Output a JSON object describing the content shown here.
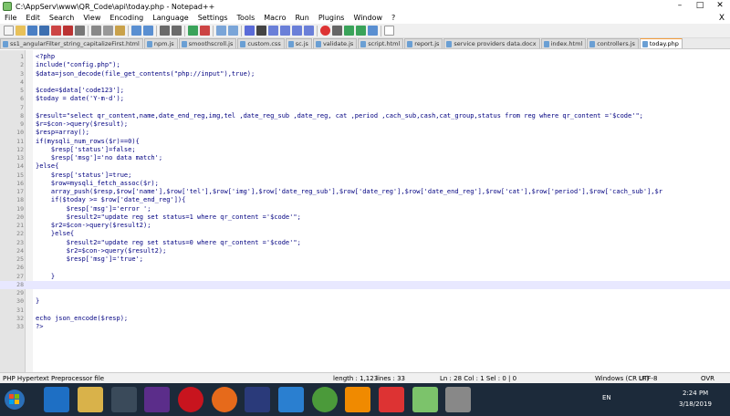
{
  "window": {
    "title": "C:\\AppServ\\www\\QR_Code\\api\\today.php - Notepad++",
    "minimize": "–",
    "maximize": "□",
    "close": "✕"
  },
  "menu": {
    "items": [
      "File",
      "Edit",
      "Search",
      "View",
      "Encoding",
      "Language",
      "Settings",
      "Tools",
      "Macro",
      "Run",
      "Plugins",
      "Window",
      "?"
    ],
    "close_doc": "X"
  },
  "tabs": [
    {
      "label": "ss1_angularFilter_string_capitalizeFirst.html"
    },
    {
      "label": "npm.js"
    },
    {
      "label": "smoothscroll.js"
    },
    {
      "label": "custom.css"
    },
    {
      "label": "sc.js"
    },
    {
      "label": "validate.js"
    },
    {
      "label": "script.html"
    },
    {
      "label": "report.js"
    },
    {
      "label": "service providers data.docx"
    },
    {
      "label": "index.html"
    },
    {
      "label": "controllers.js"
    },
    {
      "label": "today.php",
      "active": true
    }
  ],
  "code": {
    "lines": [
      {
        "n": "1",
        "text": "<?php"
      },
      {
        "n": "2",
        "text": "include(\"config.php\");"
      },
      {
        "n": "3",
        "text": "$data=json_decode(file_get_contents(\"php://input\"),true);"
      },
      {
        "n": "4",
        "text": ""
      },
      {
        "n": "5",
        "text": "$code=$data['code123'];"
      },
      {
        "n": "6",
        "text": "$today = date('Y-m-d');"
      },
      {
        "n": "7",
        "text": ""
      },
      {
        "n": "8",
        "text": "$result=\"select qr_content,name,date_end_reg,img,tel ,date_reg_sub ,date_reg, cat ,period ,cach_sub,cash,cat_group,status from reg where qr_content ='$code'\";"
      },
      {
        "n": "9",
        "text": "$r=$con->query($result);"
      },
      {
        "n": "10",
        "text": "$resp=array();"
      },
      {
        "n": "11",
        "text": "if(mysqli_num_rows($r)==0){"
      },
      {
        "n": "12",
        "text": "    $resp['status']=false;"
      },
      {
        "n": "13",
        "text": "    $resp['msg']='no data match';"
      },
      {
        "n": "14",
        "text": "}else{"
      },
      {
        "n": "15",
        "text": "    $resp['status']=true;"
      },
      {
        "n": "16",
        "text": "    $row=mysqli_fetch_assoc($r);"
      },
      {
        "n": "17",
        "text": "    array_push($resp,$row['name'],$row['tel'],$row['img'],$row['date_reg_sub'],$row['date_reg'],$row['date_end_reg'],$row['cat'],$row['period'],$row['cach_sub'],$r"
      },
      {
        "n": "18",
        "text": "    if($today >= $row['date_end_reg']){"
      },
      {
        "n": "19",
        "text": "        $resp['msg']='error ';"
      },
      {
        "n": "20",
        "text": "        $result2=\"update reg set status=1 where qr_content ='$code'\";"
      },
      {
        "n": "21",
        "text": "    $r2=$con->query($result2);"
      },
      {
        "n": "22",
        "text": "    }else{"
      },
      {
        "n": "23",
        "text": "        $result2=\"update reg set status=0 where qr_content ='$code'\";"
      },
      {
        "n": "24",
        "text": "        $r2=$con->query($result2);"
      },
      {
        "n": "25",
        "text": "        $resp['msg']='true';"
      },
      {
        "n": "26",
        "text": ""
      },
      {
        "n": "27",
        "text": "    }"
      },
      {
        "n": "28",
        "text": ""
      },
      {
        "n": "29",
        "text": ""
      },
      {
        "n": "30",
        "text": "}"
      },
      {
        "n": "31",
        "text": ""
      },
      {
        "n": "32",
        "text": "echo json_encode($resp);"
      },
      {
        "n": "33",
        "text": "?>"
      }
    ],
    "current_line": 28
  },
  "status": {
    "filetype": "PHP Hypertext Preprocessor file",
    "length": "length : 1,123",
    "lines": "lines : 33",
    "position": "Ln : 28   Col : 1   Sel : 0 | 0",
    "eol": "Windows (CR LF)",
    "encoding": "UTF-8",
    "mode": "OVR"
  },
  "taskbar": {
    "language": "EN",
    "time": "2:24 PM",
    "date": "3/18/2019"
  }
}
